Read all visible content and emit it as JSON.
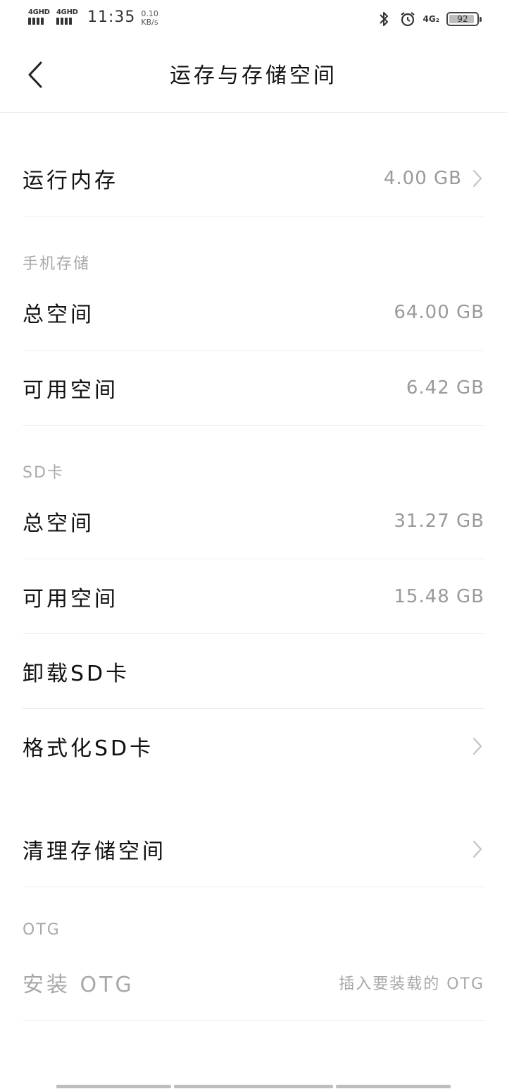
{
  "status_bar": {
    "signal1": "4GHD",
    "signal2": "4GHD",
    "time": "11:35",
    "net_speed_value": "0.10",
    "net_speed_unit": "KB/s",
    "network": "4G₂",
    "battery": "92",
    "battery_level": 0.92
  },
  "header": {
    "title": "运存与存储空间"
  },
  "ram": {
    "label": "运行内存",
    "value": "4.00 GB"
  },
  "phone_storage": {
    "section_label": "手机存储",
    "total_label": "总空间",
    "total_value": "64.00 GB",
    "available_label": "可用空间",
    "available_value": "6.42 GB"
  },
  "sd_card": {
    "section_label": "SD卡",
    "total_label": "总空间",
    "total_value": "31.27 GB",
    "available_label": "可用空间",
    "available_value": "15.48 GB",
    "unmount_label": "卸载SD卡",
    "format_label": "格式化SD卡"
  },
  "cleanup": {
    "label": "清理存储空间"
  },
  "otg": {
    "section_label": "OTG",
    "install_label": "安装 OTG",
    "install_hint": "插入要装载的 OTG"
  },
  "icons": {
    "back": "chevron-left-icon",
    "row_arrow": "chevron-right-icon",
    "bluetooth": "bluetooth-icon",
    "alarm": "alarm-icon"
  }
}
